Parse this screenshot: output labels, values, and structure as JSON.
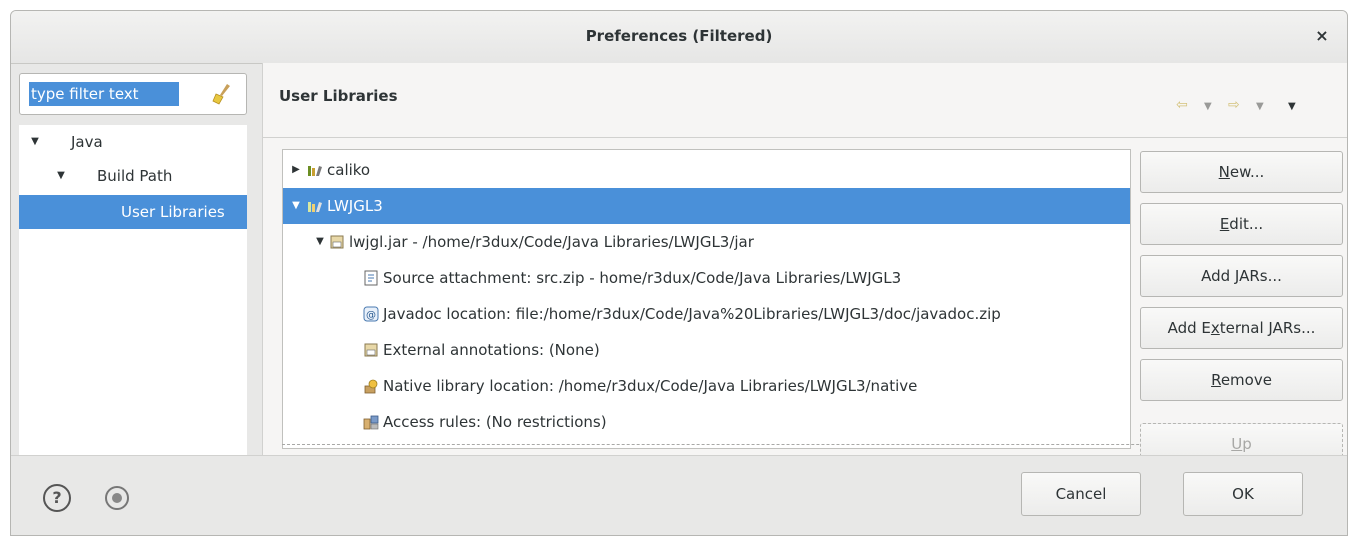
{
  "window": {
    "title": "Preferences (Filtered)",
    "close_label": "×"
  },
  "filter": {
    "placeholder": "type filter text"
  },
  "nav_tree": [
    {
      "label": "Java",
      "expanded": true
    },
    {
      "label": "Build Path",
      "expanded": true
    },
    {
      "label": "User Libraries",
      "selected": true
    }
  ],
  "page": {
    "title": "User Libraries"
  },
  "libraries": [
    {
      "label": "caliko",
      "expanded": false
    },
    {
      "label": "LWJGL3",
      "expanded": true,
      "selected": true
    },
    {
      "label": "lwjgl.jar - /home/r3dux/Code/Java Libraries/LWJGL3/jar",
      "expanded": true
    },
    {
      "label": "Source attachment: src.zip - home/r3dux/Code/Java Libraries/LWJGL3"
    },
    {
      "label": "Javadoc location: file:/home/r3dux/Code/Java%20Libraries/LWJGL3/doc/javadoc.zip"
    },
    {
      "label": "External annotations: (None)"
    },
    {
      "label": "Native library location: /home/r3dux/Code/Java Libraries/LWJGL3/native"
    },
    {
      "label": "Access rules: (No restrictions)"
    }
  ],
  "buttons": {
    "new": {
      "pre": "",
      "u": "N",
      "post": "ew..."
    },
    "edit": {
      "pre": "",
      "u": "E",
      "post": "dit..."
    },
    "add_jars": {
      "pre": "Add ",
      "u": "J",
      "post": "ARs..."
    },
    "add_external_jars": {
      "pre": "Add E",
      "u": "x",
      "post": "ternal JARs..."
    },
    "remove": {
      "pre": "",
      "u": "R",
      "post": "emove"
    },
    "up": {
      "pre": "",
      "u": "U",
      "post": "p"
    }
  },
  "dialog_buttons": {
    "cancel": "Cancel",
    "ok": "OK"
  },
  "colors": {
    "selection": "#4a90d9",
    "dialog_bg": "#e8e8e7"
  }
}
